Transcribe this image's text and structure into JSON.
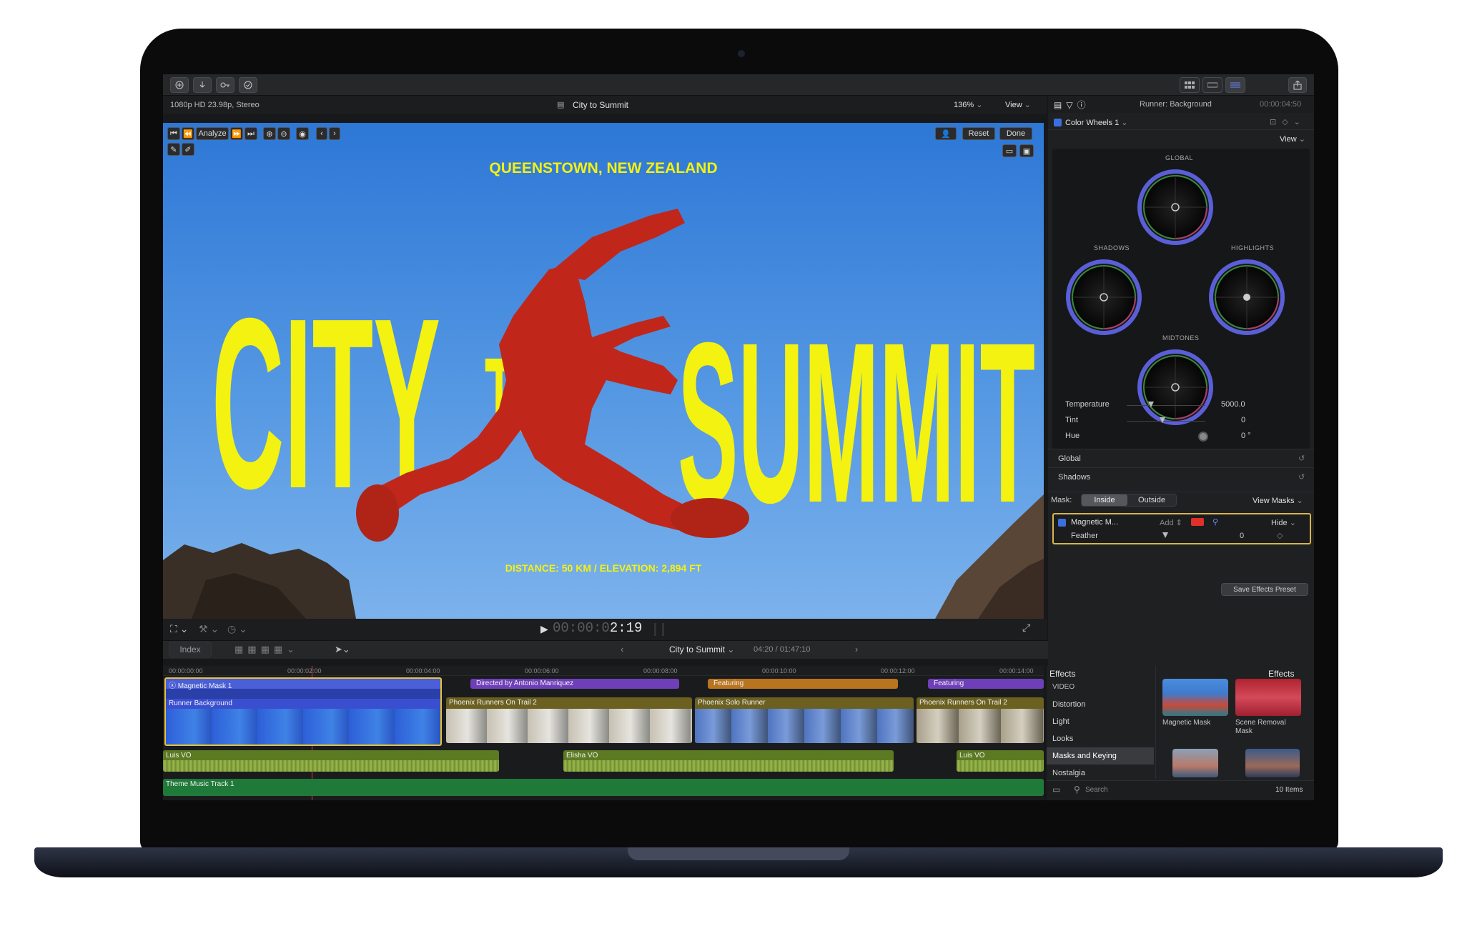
{
  "app": {
    "project_title": "City to Summit",
    "format": "1080p HD 23.98p, Stereo",
    "zoom": "136%",
    "view_label": "View"
  },
  "toolbar": {
    "analyze_label": "Analyze",
    "reset_label": "Reset",
    "done_label": "Done"
  },
  "viewer": {
    "location_text": "QUEENSTOWN, NEW ZEALAND",
    "title_part1": "CITY",
    "title_part2": "TO",
    "title_part3": "SUMMIT",
    "stats_text": "DISTANCE: 50 KM / ELEVATION: 2,894 FT",
    "timecode_dim": "00:00:0",
    "timecode_bright": "2:19"
  },
  "inspector": {
    "clip_name": "Runner: Background",
    "duration": "00:00:04:50",
    "effect_name": "Color Wheels 1",
    "view_label": "View",
    "wheels": {
      "global": "GLOBAL",
      "shadows": "SHADOWS",
      "highlights": "HIGHLIGHTS",
      "midtones": "MIDTONES"
    },
    "sliders": [
      {
        "label": "Temperature",
        "value": "5000.0"
      },
      {
        "label": "Tint",
        "value": "0"
      },
      {
        "label": "Hue",
        "value": "0 °"
      }
    ],
    "sections": [
      "Global",
      "Shadows"
    ],
    "mask_label": "Mask:",
    "mask_inside": "Inside",
    "mask_outside": "Outside",
    "view_masks": "View Masks",
    "magnetic_mask_name": "Magnetic M...",
    "add_label": "Add",
    "hide_label": "Hide",
    "feather_label": "Feather",
    "feather_value": "0",
    "save_preset": "Save Effects Preset",
    "mask_color": "#e0302a"
  },
  "timeline_bar": {
    "index_label": "Index",
    "project_name": "City to Summit",
    "time_info": "04:20 / 01:47:10"
  },
  "timeline": {
    "ruler": [
      "00:00:00:00",
      "00:00:02:00",
      "00:00:04:00",
      "00:00:06:00",
      "00:00:08:00",
      "00:00:10:00",
      "00:00:12:00",
      "00:00:14:00"
    ],
    "magnetic_mask_clip": "Magnetic Mask 1",
    "titles": [
      "Directed by Antonio Manriquez",
      "Featuring",
      "Featuring"
    ],
    "video_clips": [
      "Runner Background",
      "Phoenix Runners On Trail 2",
      "Phoenix Solo Runner",
      "Phoenix Runners On Trail 2"
    ],
    "audio_clips": [
      "Luis VO",
      "Elisha VO",
      "Luis VO"
    ],
    "music_clip": "Theme Music Track 1"
  },
  "browser": {
    "header_left": "Effects",
    "header_right": "Effects",
    "categories": [
      "VIDEO",
      "Distortion",
      "Light",
      "Looks",
      "Masks and Keying",
      "Nostalgia"
    ],
    "effects": [
      "Magnetic Mask",
      "Scene Removal Mask"
    ],
    "search_placeholder": "Search",
    "item_count": "10 Items"
  },
  "colors": {
    "accent_yellow": "#f4f210",
    "runner_red": "#c0271a",
    "selection_yellow": "#e8c23a",
    "clip_blue": "#3a4fd0",
    "title_purple": "#6e3fb8",
    "audio_green": "#5c7a22"
  }
}
